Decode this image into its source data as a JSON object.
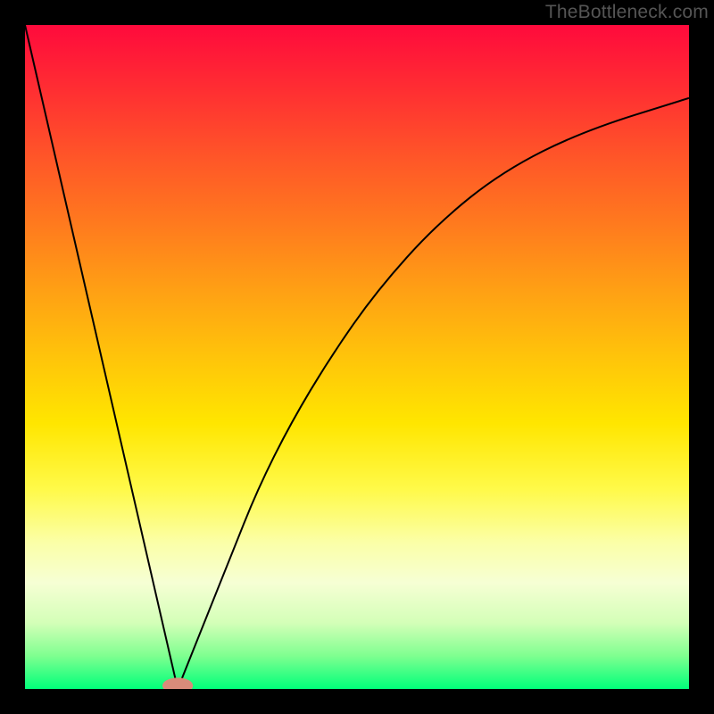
{
  "watermark": "TheBottleneck.com",
  "chart_data": {
    "type": "line",
    "title": "",
    "xlabel": "",
    "ylabel": "",
    "xlim": [
      0,
      100
    ],
    "ylim": [
      0,
      100
    ],
    "grid": false,
    "legend": false,
    "background_gradient": {
      "top": "#ff0a3c",
      "mid": "#ffe600",
      "bottom": "#00ff7a"
    },
    "series": [
      {
        "name": "left-branch",
        "x": [
          0,
          23
        ],
        "y": [
          100,
          0
        ],
        "stroke": "#000000",
        "width": 2
      },
      {
        "name": "right-branch",
        "x": [
          23,
          27,
          31,
          35,
          40,
          46,
          53,
          62,
          72,
          84,
          100
        ],
        "y": [
          0,
          10,
          20,
          30,
          40,
          50,
          60,
          70,
          78,
          84,
          89
        ],
        "stroke": "#000000",
        "width": 2
      }
    ],
    "marker": {
      "name": "minimum-marker",
      "x": 23,
      "y": 0,
      "color": "#d98b7a",
      "rx": 2.3,
      "ry": 1.2
    }
  }
}
